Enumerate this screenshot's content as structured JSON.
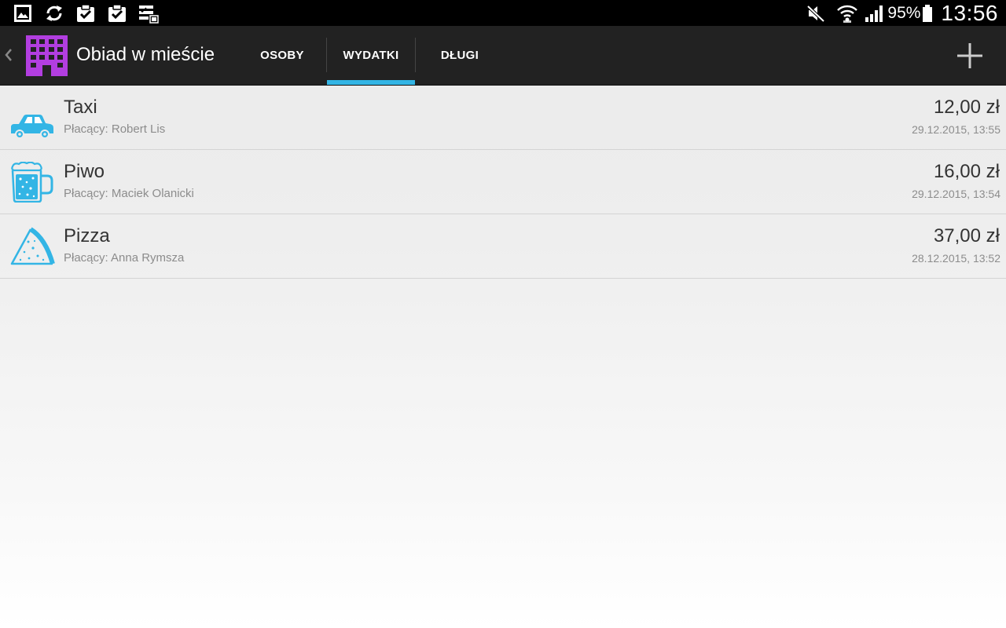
{
  "status_bar": {
    "notification_icons": [
      "gallery-icon",
      "sync-icon",
      "clipboard-check-icon",
      "clipboard-check-icon",
      "checklist-icon"
    ],
    "status_icons": [
      "mute-icon",
      "wifi-icon",
      "signal-icon",
      "battery-icon"
    ],
    "battery_percent": "95%",
    "time": "13:56"
  },
  "action_bar": {
    "group_title": "Obiad w mieście",
    "tabs": [
      {
        "label": "OSOBY",
        "selected": false
      },
      {
        "label": "WYDATKI",
        "selected": true
      },
      {
        "label": "DŁUGI",
        "selected": false
      }
    ],
    "accent_color": "#33b5e5",
    "app_icon_color": "#b23ee0"
  },
  "expenses": [
    {
      "icon": "car-icon",
      "name": "Taxi",
      "payer": "Płacący: Robert Lis",
      "amount": "12,00 zł",
      "date": "29.12.2015, 13:55"
    },
    {
      "icon": "beer-mug-icon",
      "name": "Piwo",
      "payer": "Płacący: Maciek Olanicki",
      "amount": "16,00 zł",
      "date": "29.12.2015, 13:54"
    },
    {
      "icon": "pizza-slice-icon",
      "name": "Pizza",
      "payer": "Płacący: Anna Rymsza",
      "amount": "37,00 zł",
      "date": "28.12.2015, 13:52"
    }
  ],
  "icon_color": "#33b5e5"
}
